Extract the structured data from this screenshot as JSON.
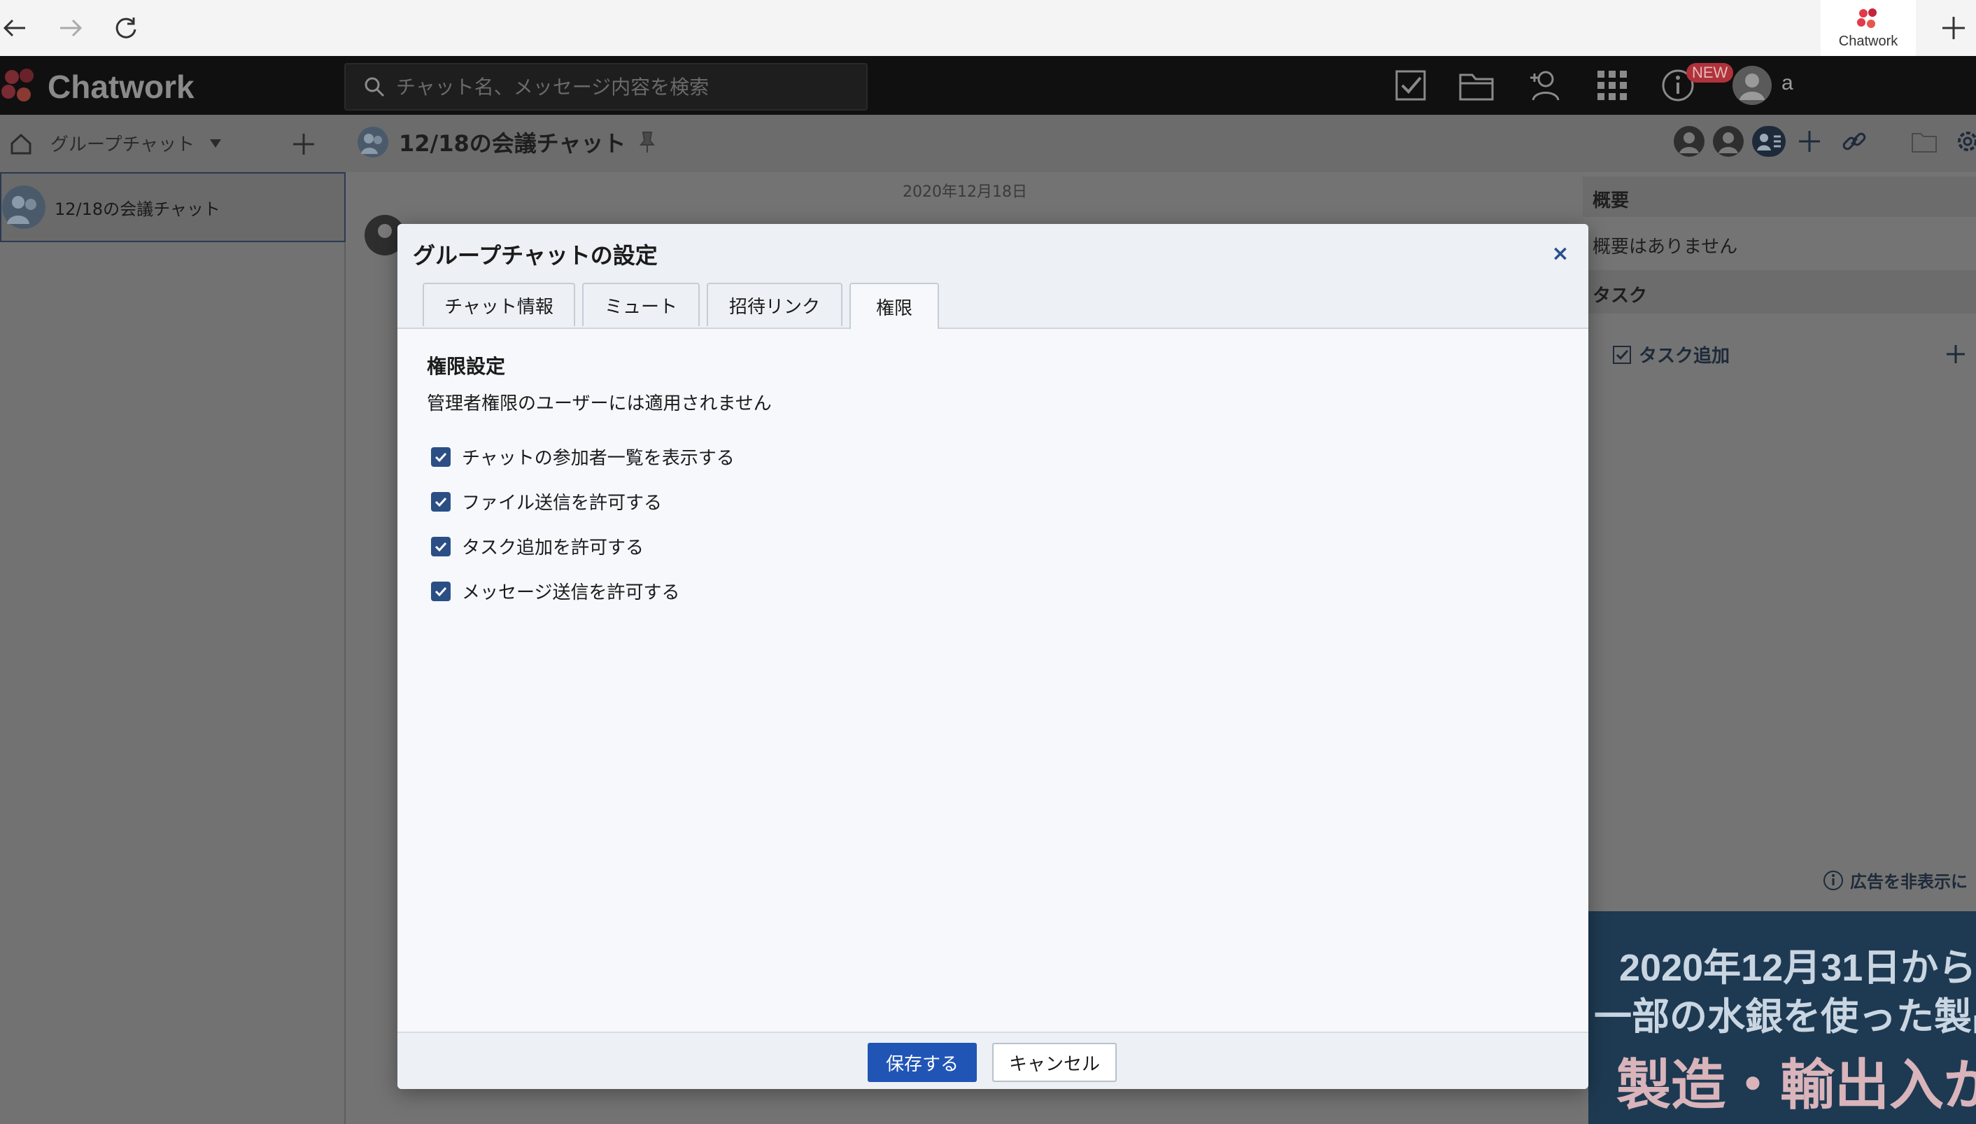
{
  "browser": {
    "extension_label": "Chatwork"
  },
  "app": {
    "logo_text": "Chatwork",
    "search_placeholder": "チャット名、メッセージ内容を検索",
    "new_badge": "NEW",
    "username": "a"
  },
  "sidebar": {
    "group_dropdown_label": "グループチャット",
    "rooms": [
      {
        "name": "12/18の会議チャット"
      }
    ]
  },
  "room": {
    "title": "12/18の会議チャット",
    "date": "2020年12月18日"
  },
  "right_panel": {
    "overview_label": "概要",
    "overview_empty": "概要はありません",
    "task_label": "タスク",
    "add_task_label": "タスク追加",
    "ad_hide_label": "広告を非表示に",
    "ad_lines": [
      "2020年12月31日から",
      "一部の水銀を使った製品の",
      "製造・輸出入が"
    ]
  },
  "modal": {
    "title": "グループチャットの設定",
    "close_label": "×",
    "tabs": [
      {
        "label": "チャット情報",
        "active": false
      },
      {
        "label": "ミュート",
        "active": false
      },
      {
        "label": "招待リンク",
        "active": false
      },
      {
        "label": "権限",
        "active": true
      }
    ],
    "section_title": "権限設定",
    "section_desc": "管理者権限のユーザーには適用されません",
    "options": [
      {
        "label": "チャットの参加者一覧を表示する",
        "checked": true
      },
      {
        "label": "ファイル送信を許可する",
        "checked": true
      },
      {
        "label": "タスク追加を許可する",
        "checked": true
      },
      {
        "label": "メッセージ送信を許可する",
        "checked": true
      }
    ],
    "save_label": "保存する",
    "cancel_label": "キャンセル"
  },
  "colors": {
    "accent": "#2055b6",
    "checkbox": "#2b4f85",
    "badge": "#b0323a"
  }
}
